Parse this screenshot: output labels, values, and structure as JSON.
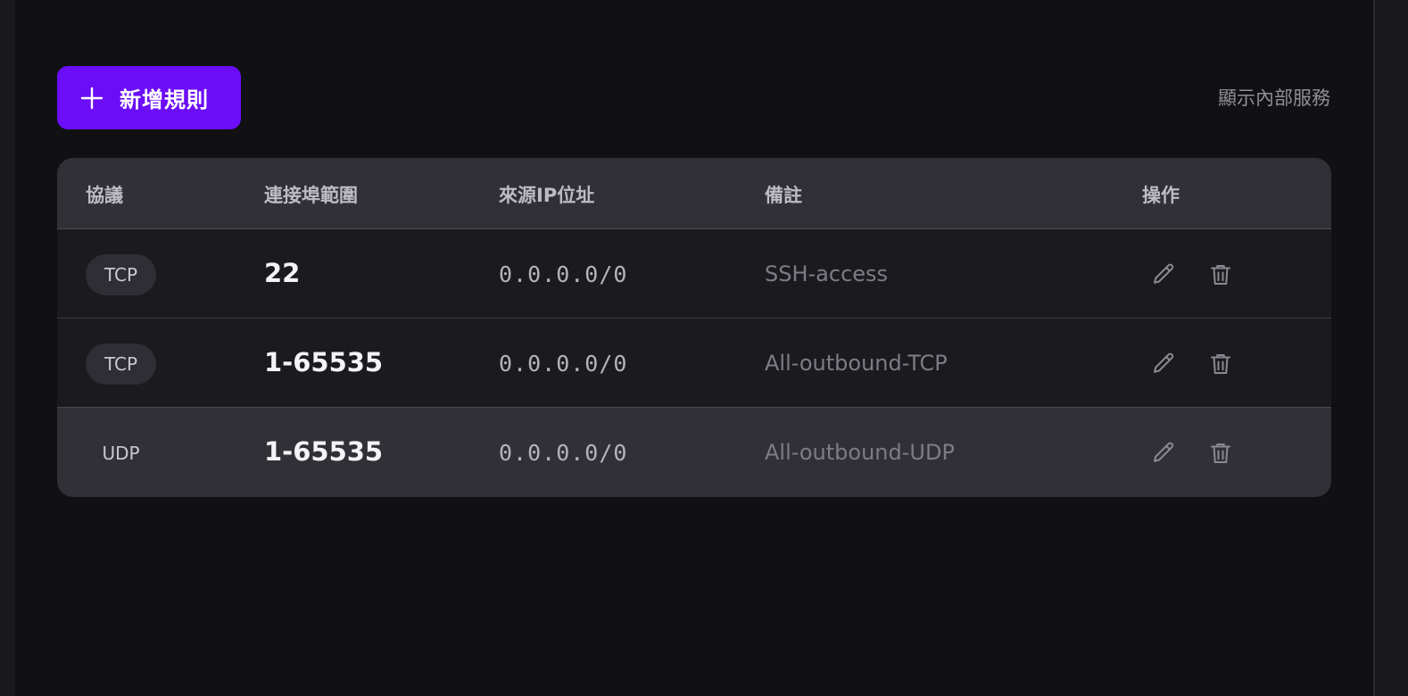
{
  "toolbar": {
    "add_rule_label": "新增規則",
    "show_internal_label": "顯示內部服務"
  },
  "table": {
    "columns": [
      "協議",
      "連接埠範圍",
      "來源IP位址",
      "備註",
      "操作"
    ],
    "rows": [
      {
        "protocol": "TCP",
        "port_range": "22",
        "source_ip": "0.0.0.0/0",
        "note": "SSH-access"
      },
      {
        "protocol": "TCP",
        "port_range": "1-65535",
        "source_ip": "0.0.0.0/0",
        "note": "All-outbound-TCP"
      },
      {
        "protocol": "UDP",
        "port_range": "1-65535",
        "source_ip": "0.0.0.0/0",
        "note": "All-outbound-UDP"
      }
    ]
  },
  "icons": {
    "add": "plus-icon",
    "edit": "pencil-icon",
    "delete": "trash-icon"
  },
  "colors": {
    "accent": "#6b0df7",
    "background": "#111113",
    "header_bg": "#323037",
    "row_bg": "#1b1b1f"
  }
}
